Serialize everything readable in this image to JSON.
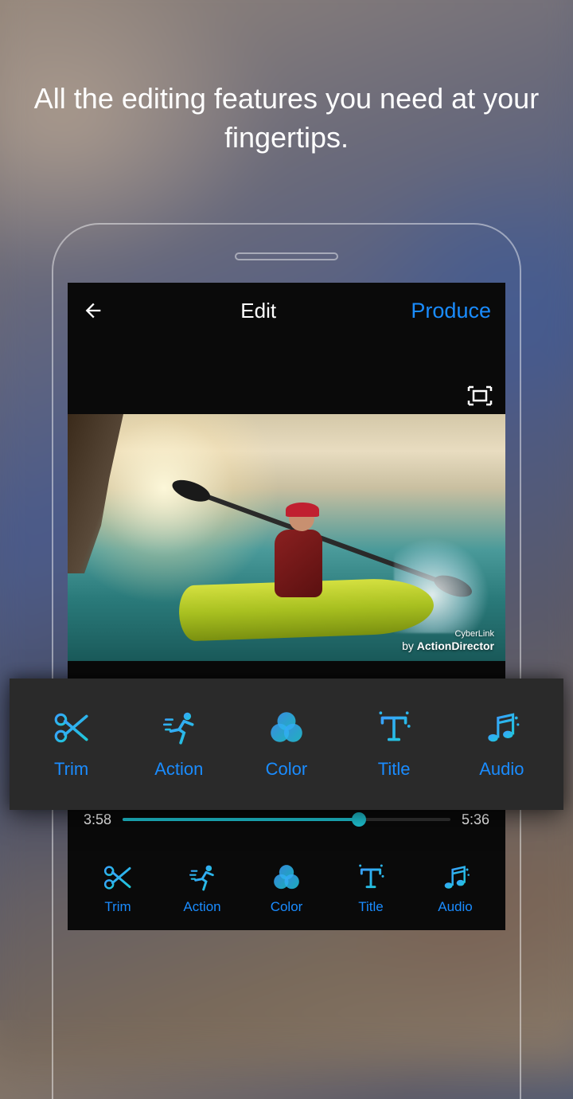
{
  "tagline": "All the editing features you need at your fingertips.",
  "topbar": {
    "title": "Edit",
    "action": "Produce"
  },
  "watermark": {
    "top": "CyberLink",
    "by": "by ",
    "name": "ActionDirector"
  },
  "timeline": {
    "current": "3:58",
    "duration": "5:36",
    "progress_pct": 72
  },
  "tools_popout": [
    {
      "id": "trim",
      "label": "Trim",
      "icon": "scissors"
    },
    {
      "id": "action",
      "label": "Action",
      "icon": "runner"
    },
    {
      "id": "color",
      "label": "Color",
      "icon": "venn"
    },
    {
      "id": "title",
      "label": "Title",
      "icon": "text"
    },
    {
      "id": "audio",
      "label": "Audio",
      "icon": "music"
    }
  ],
  "tools_bottom": [
    {
      "id": "trim",
      "label": "Trim",
      "icon": "scissors"
    },
    {
      "id": "action",
      "label": "Action",
      "icon": "runner"
    },
    {
      "id": "color",
      "label": "Color",
      "icon": "venn"
    },
    {
      "id": "title",
      "label": "Title",
      "icon": "text"
    },
    {
      "id": "audio",
      "label": "Audio",
      "icon": "music"
    }
  ],
  "colors": {
    "accent": "#1a8cff",
    "cyan": "#1fc8d8"
  }
}
